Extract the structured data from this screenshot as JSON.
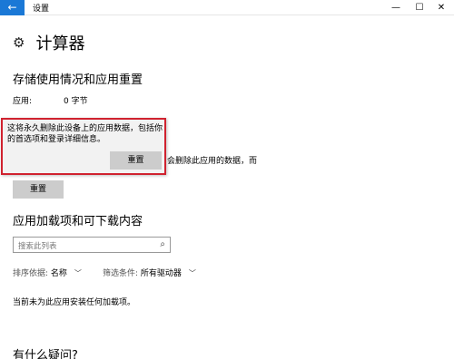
{
  "window": {
    "title": "设置",
    "back_icon": "←",
    "min_icon": "—",
    "max_icon": "☐",
    "close_icon": "✕"
  },
  "page": {
    "icon": "⚙",
    "title": "计算器"
  },
  "storage": {
    "heading": "存储使用情况和应用重置",
    "app_label": "应用:",
    "app_value": "0 字节"
  },
  "flyout": {
    "message": "这将永久删除此设备上的应用数据，包括你的首选项和登录详细信息。",
    "button": "重置"
  },
  "partial_text": "会删除此应用的数据，而",
  "reset_button": "重置",
  "addons": {
    "heading": "应用加载项和可下载内容",
    "search_placeholder": "搜索此列表",
    "sort_label": "排序依据:",
    "sort_value": "名称",
    "filter_label": "筛选条件:",
    "filter_value": "所有驱动器",
    "empty_note": "当前未为此应用安装任何加载项。"
  },
  "help_heading": "有什么疑问?"
}
